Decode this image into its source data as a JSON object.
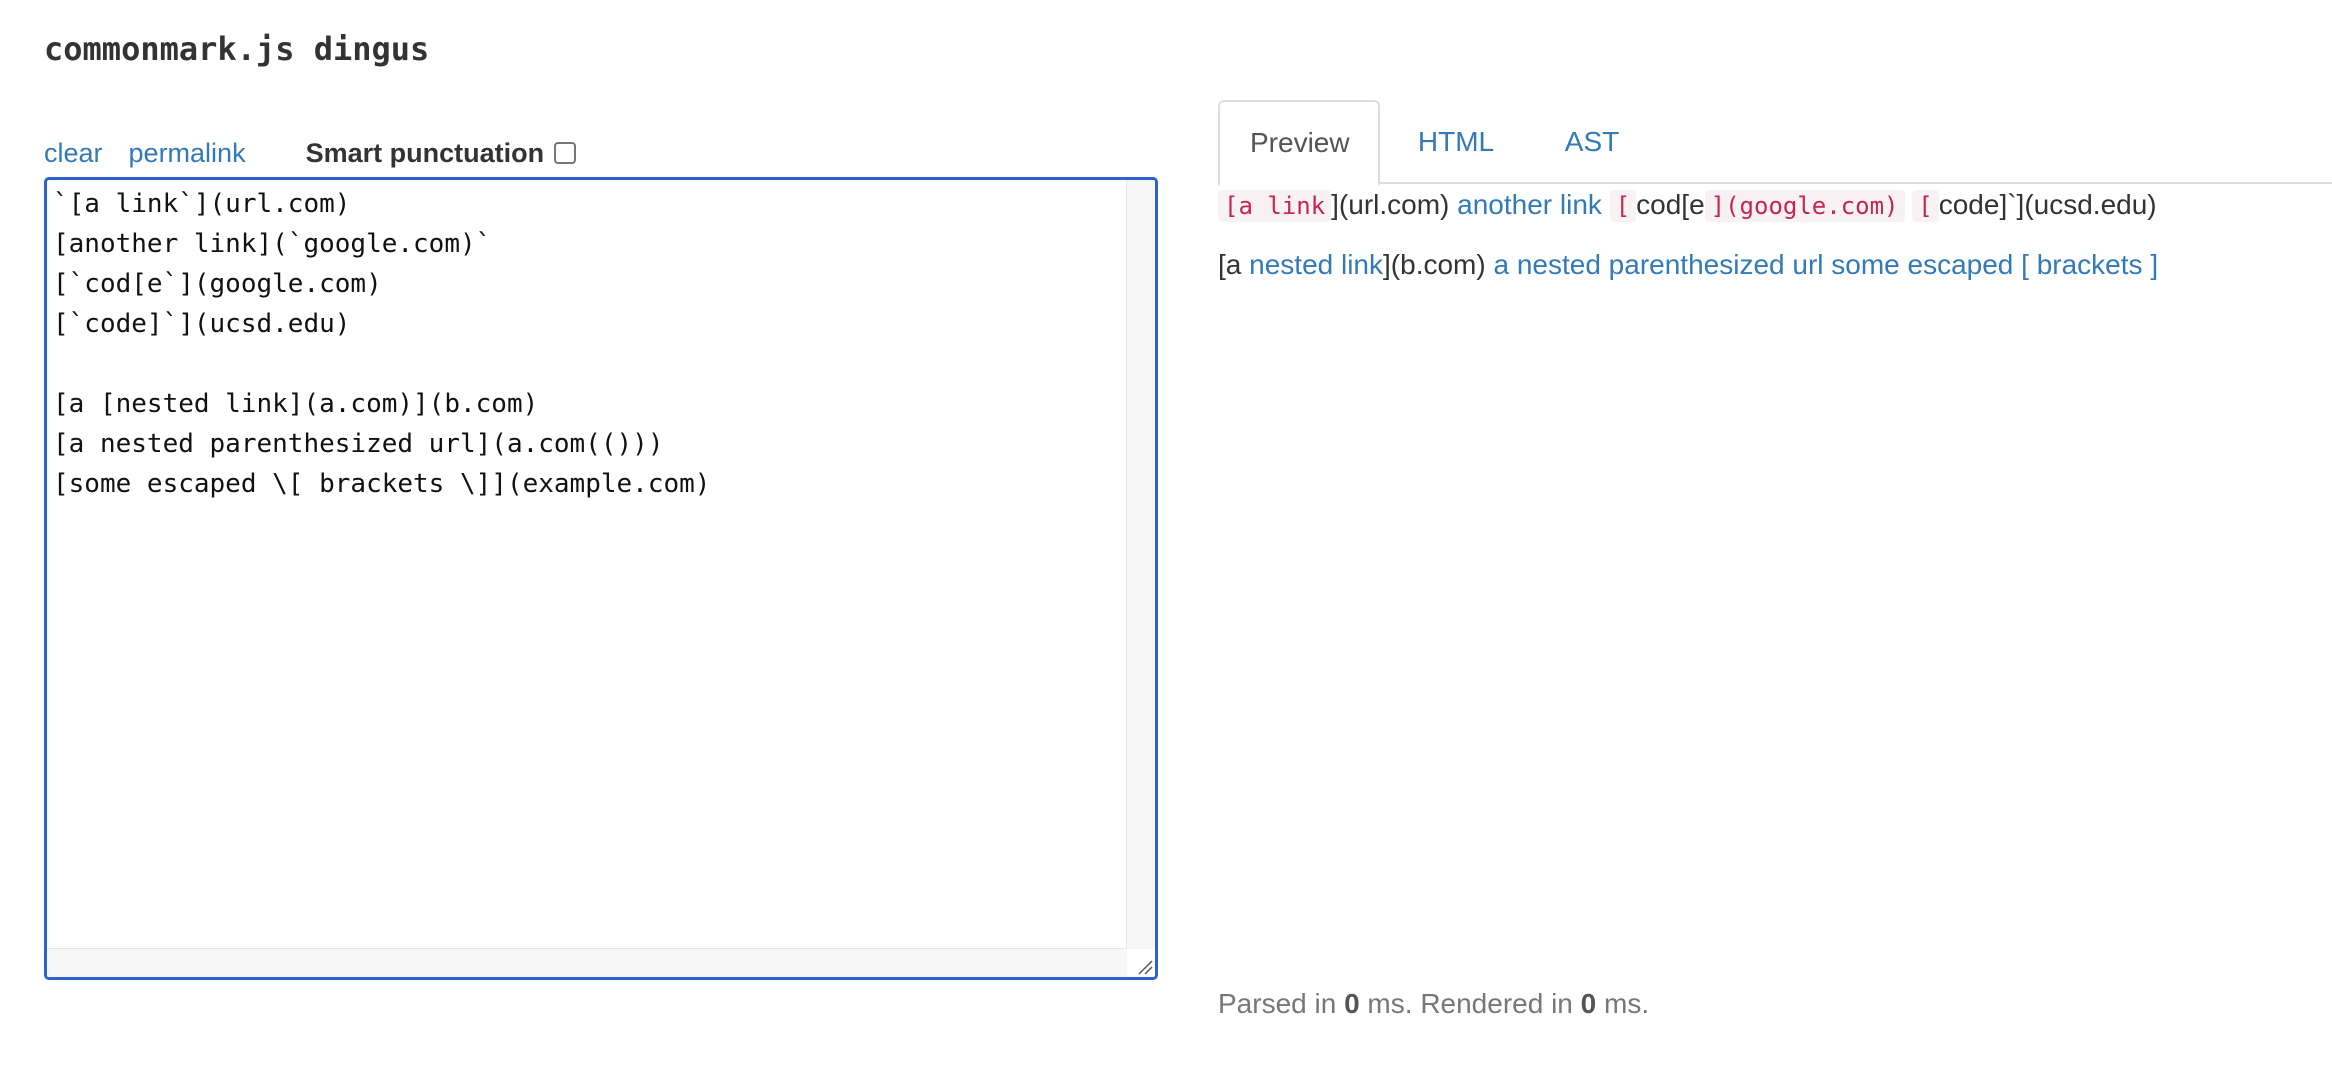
{
  "title": "commonmark.js dingus",
  "controls": {
    "clear": "clear",
    "permalink": "permalink",
    "smart_punctuation": "Smart punctuation"
  },
  "editor": {
    "text": "`[a link`](url.com)\n[another link](`google.com)`\n[`cod[e`](google.com)\n[`code]`](ucsd.edu)\n\n[a [nested link](a.com)](b.com)\n[a nested parenthesized url](a.com(()))\n[some escaped \\[ brackets \\]](example.com)"
  },
  "tabs": {
    "preview": "Preview",
    "html": "HTML",
    "ast": "AST"
  },
  "preview": {
    "line1": {
      "code1": "[a link",
      "text1": "](url.com) ",
      "link1": "another link",
      "text2": " ",
      "code2": "[",
      "text3": "cod[e",
      "code3": "](google.com)",
      "text4": " ",
      "code4": "[",
      "text5": "code]`](ucsd.edu)"
    },
    "line2": {
      "text1": "[a ",
      "link1": "nested link",
      "text2": "](b.com) ",
      "link2": "a nested parenthesized url",
      "text3": " ",
      "link3": "some escaped [ brackets ]"
    }
  },
  "timing": {
    "parsed_label": "Parsed in ",
    "parsed_value": "0",
    "rendered_label": " ms. Rendered in ",
    "rendered_value": "0",
    "suffix": " ms."
  },
  "colors": {
    "link": "#337ab7",
    "code": "#c7254e",
    "code_bg": "#f9f2f4",
    "editor_border": "#2d62c9"
  }
}
